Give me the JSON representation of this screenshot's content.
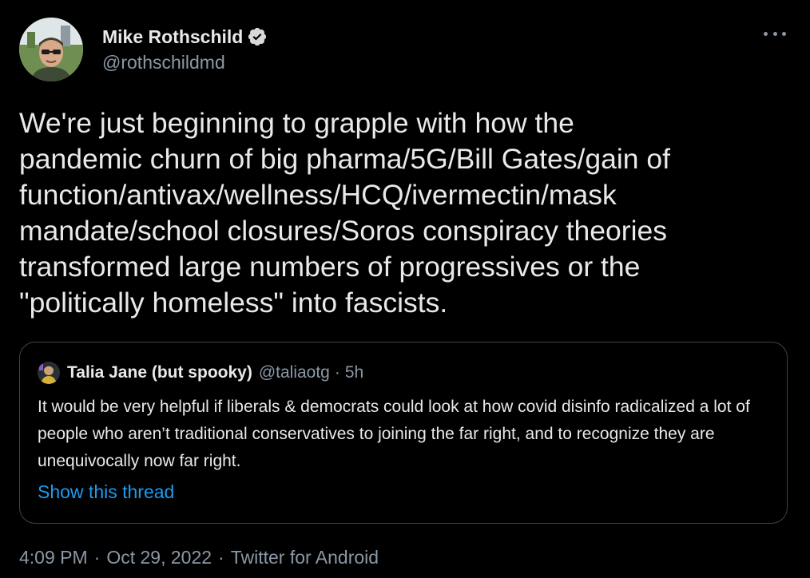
{
  "author": {
    "display_name": "Mike Rothschild",
    "handle": "@rothschildmd",
    "verified": true,
    "verified_icon": "verified-badge-icon"
  },
  "more_icon": "more-dots-icon",
  "tweet": {
    "text": "We're just beginning to grapple with how the\npandemic churn of big pharma/5G/Bill Gates/gain of\nfunction/antivax/wellness/HCQ/ivermectin/mask\nmandate/school closures/Soros conspiracy theories\ntransformed large numbers of progressives or the\n\"politically homeless\" into fascists."
  },
  "quote": {
    "display_name": "Talia Jane (but spooky)",
    "handle": "@taliaotg",
    "dot": "·",
    "time": "5h",
    "text": "It would be very helpful if liberals & democrats could look at how covid disinfo radicalized a lot of people who aren’t traditional conservatives to joining the far right, and to recognize they are unequivocally now far right.",
    "show_thread": "Show this thread"
  },
  "meta": {
    "time": "4:09 PM",
    "sep1": "·",
    "date": "Oct 29, 2022",
    "sep2": "·",
    "source": "Twitter for Android"
  },
  "colors": {
    "background": "#000000",
    "text": "#e7e9ea",
    "secondary": "#8b98a5",
    "link": "#1d9bf0",
    "border": "#3e4347"
  }
}
